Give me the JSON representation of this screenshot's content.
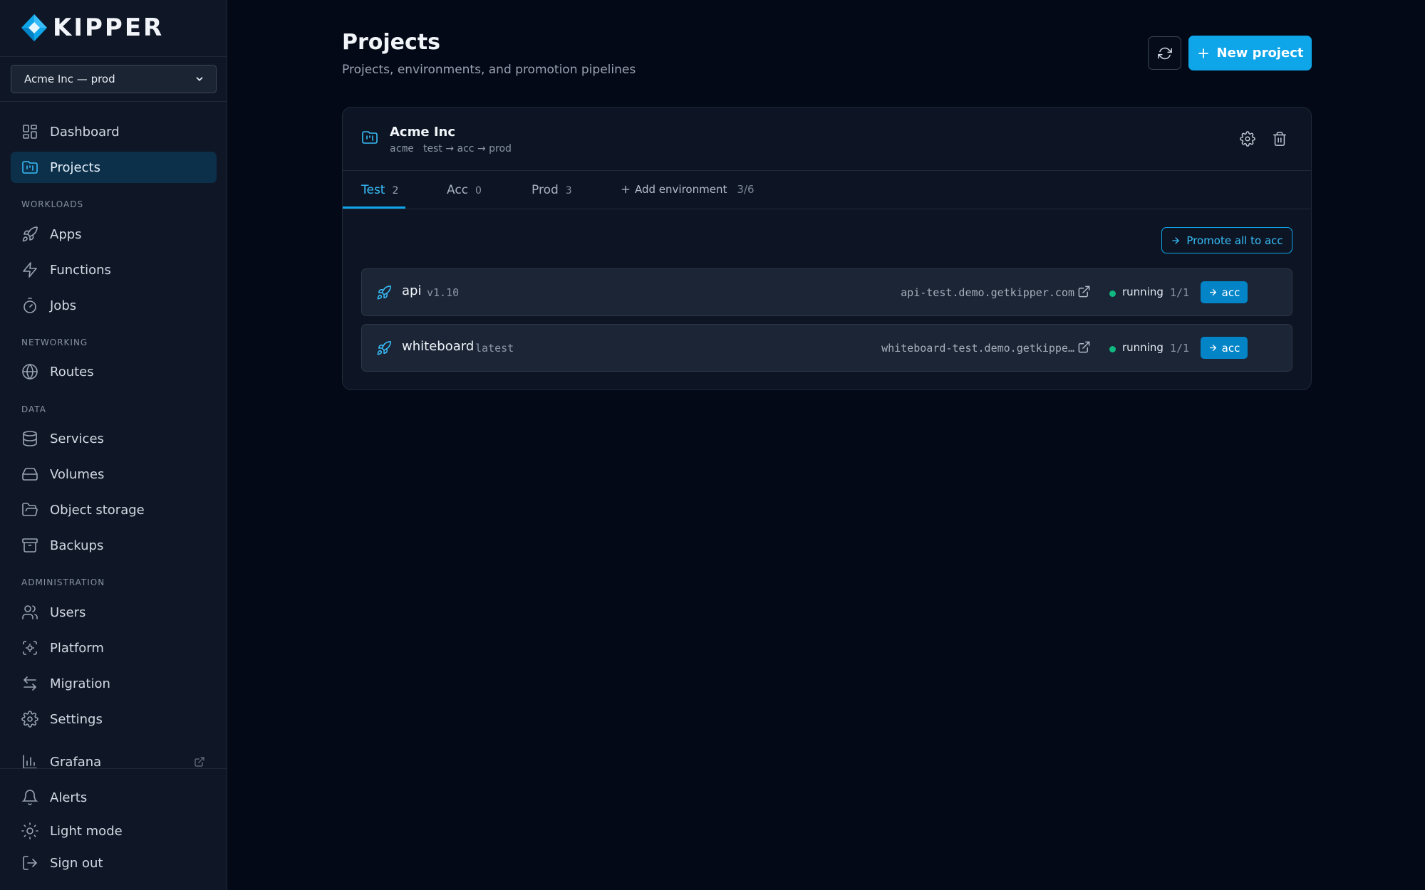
{
  "brand": {
    "name": "KIPPER"
  },
  "cluster_select": {
    "value": "Acme Inc — prod"
  },
  "nav": {
    "main": [
      {
        "label": "Dashboard",
        "icon": "dashboard-icon"
      },
      {
        "label": "Projects",
        "icon": "folder-kanban-icon",
        "active": true
      }
    ],
    "sections": [
      {
        "title": "WORKLOADS",
        "items": [
          "Apps",
          "Functions",
          "Jobs"
        ]
      },
      {
        "title": "NETWORKING",
        "items": [
          "Routes"
        ]
      },
      {
        "title": "DATA",
        "items": [
          "Services",
          "Volumes",
          "Object storage",
          "Backups"
        ]
      },
      {
        "title": "ADMINISTRATION",
        "items": [
          "Users",
          "Platform",
          "Migration",
          "Settings"
        ]
      }
    ],
    "grafana": "Grafana",
    "footer": [
      "Alerts",
      "Light mode",
      "Sign out"
    ]
  },
  "header": {
    "title": "Projects",
    "subtitle": "Projects, environments, and promotion pipelines",
    "new_project_label": "New project"
  },
  "project": {
    "name": "Acme Inc",
    "slug": "acme",
    "pipeline": "test → acc → prod",
    "tabs": [
      {
        "label": "Test",
        "count": "2",
        "active": true
      },
      {
        "label": "Acc",
        "count": "0"
      },
      {
        "label": "Prod",
        "count": "3"
      }
    ],
    "add_environment_label": "Add environment",
    "environment_quota": "3/6",
    "promote_all_label": "Promote all to acc",
    "apps": [
      {
        "name": "api",
        "version": "v1.10",
        "url": "api-test.demo.getkipper.com",
        "status": "running",
        "replicas": "1/1",
        "promote_label": "acc"
      },
      {
        "name": "whiteboard",
        "version": "latest",
        "url": "whiteboard-test.demo.getkippe…",
        "status": "running",
        "replicas": "1/1",
        "promote_label": "acc"
      }
    ]
  },
  "colors": {
    "accent": "#0ea5e9",
    "background": "#030916",
    "sidebar": "#0f1726",
    "status_running": "#10b981"
  }
}
